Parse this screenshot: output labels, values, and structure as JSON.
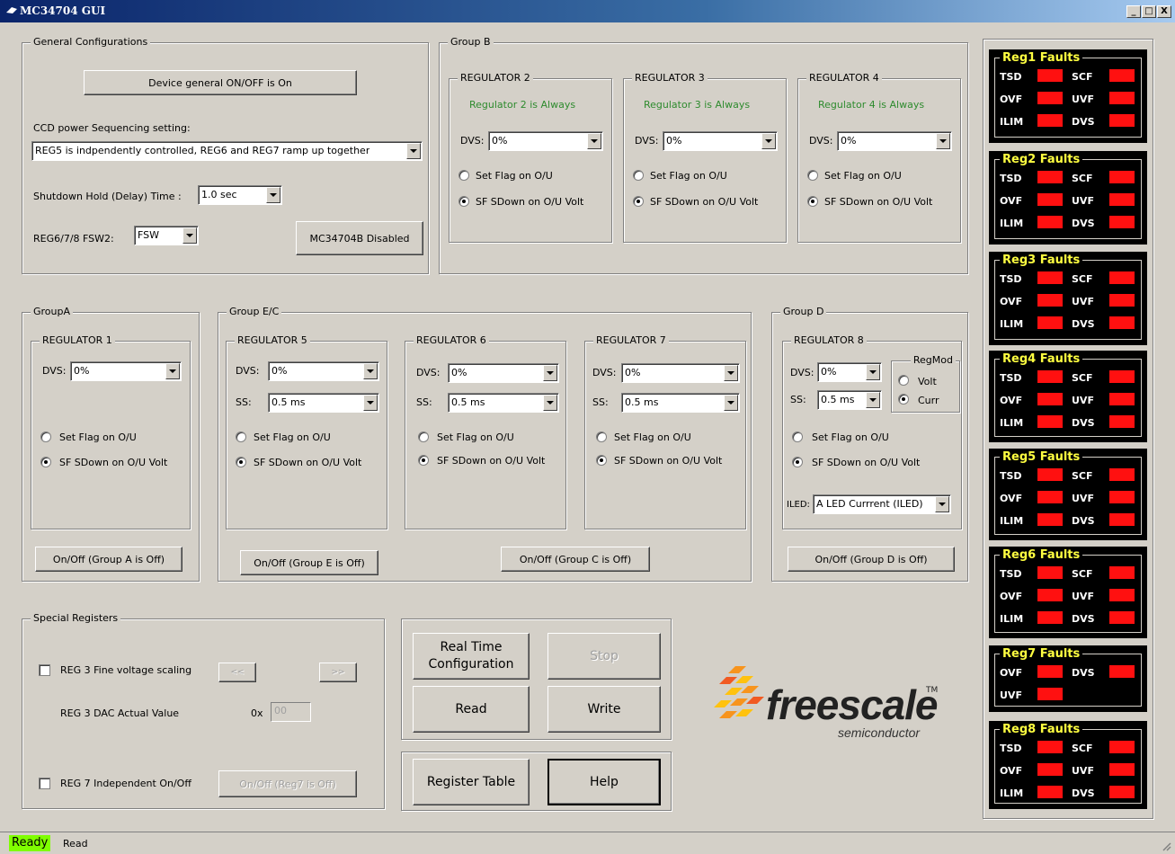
{
  "window": {
    "title": "MC34704 GUI",
    "min": "_",
    "max": "□",
    "close": "X"
  },
  "general": {
    "legend": "General Configurations",
    "device_btn": "Device general ON/OFF is On",
    "ccd_label": "CCD power Sequencing setting:",
    "ccd_value": "REG5 is indpendently controlled, REG6 and REG7 ramp up together",
    "shutdown_label": "Shutdown Hold (Delay) Time :",
    "shutdown_value": "1.0 sec",
    "fsw_label": "REG6/7/8 FSW2:",
    "fsw_value": "FSW",
    "mc_btn": "MC34704B Disabled"
  },
  "groupB": {
    "legend": "Group B",
    "regs": [
      {
        "legend": "REGULATOR 2",
        "always": "Regulator 2 is Always",
        "dvs_label": "DVS:",
        "dvs": "0%",
        "r1": "Set Flag on O/U",
        "r2": "SF SDown on O/U Volt"
      },
      {
        "legend": "REGULATOR 3",
        "always": "Regulator 3 is Always",
        "dvs_label": "DVS:",
        "dvs": "0%",
        "r1": "Set Flag on O/U",
        "r2": "SF SDown on O/U Volt"
      },
      {
        "legend": "REGULATOR 4",
        "always": "Regulator 4 is Always",
        "dvs_label": "DVS:",
        "dvs": "0%",
        "r1": "Set Flag on O/U",
        "r2": "SF SDown on O/U Volt"
      }
    ]
  },
  "groupA": {
    "legend": "GroupA",
    "reg": {
      "legend": "REGULATOR 1",
      "dvs_label": "DVS:",
      "dvs": "0%",
      "r1": "Set Flag on O/U",
      "r2": "SF SDown on O/U Volt"
    },
    "btn": "On/Off (Group A is Off)"
  },
  "groupEC": {
    "legend": "Group E/C",
    "regs": [
      {
        "legend": "REGULATOR 5",
        "dvs_label": "DVS:",
        "dvs": "0%",
        "ss_label": "SS:",
        "ss": "0.5 ms",
        "r1": "Set Flag on O/U",
        "r2": "SF SDown on O/U Volt"
      },
      {
        "legend": "REGULATOR 6",
        "dvs_label": "DVS:",
        "dvs": "0%",
        "ss_label": "SS:",
        "ss": "0.5 ms",
        "r1": "Set Flag on O/U",
        "r2": "SF SDown on O/U Volt"
      },
      {
        "legend": "REGULATOR 7",
        "dvs_label": "DVS:",
        "dvs": "0%",
        "ss_label": "SS:",
        "ss": "0.5 ms",
        "r1": "Set Flag on O/U",
        "r2": "SF SDown on O/U Volt"
      }
    ],
    "btnE": "On/Off (Group E is Off)",
    "btnC": "On/Off (Group C is Off)"
  },
  "groupD": {
    "legend": "Group D",
    "reg": {
      "legend": "REGULATOR 8",
      "dvs_label": "DVS:",
      "dvs": "0%",
      "ss_label": "SS:",
      "ss": "0.5 ms",
      "regmod_legend": "RegMod",
      "volt": "Volt",
      "curr": "Curr",
      "r1": "Set Flag on O/U",
      "r2": "SF SDown on O/U Volt",
      "iled_label": "ILED:",
      "iled": "A LED Currrent (ILED)"
    },
    "btn": "On/Off (Group D is Off)"
  },
  "special": {
    "legend": "Special Registers",
    "fine_label": "REG 3 Fine voltage scaling",
    "prev": "<<",
    "next": ">>",
    "dac_label": "REG 3 DAC Actual Value",
    "dac_prefix": "0x",
    "dac_value": "00",
    "reg7_label": "REG 7 Independent On/Off",
    "reg7_btn": "On/Off (Reg7 is Off)"
  },
  "actions": {
    "realtime": "Real Time Configuration",
    "stop": "Stop",
    "read": "Read",
    "write": "Write",
    "register": "Register Table",
    "help": "Help"
  },
  "logo": {
    "word": "freescale",
    "tm": "TM",
    "sub": "semiconductor",
    "colors": [
      "#f7941d",
      "#ffc20e",
      "#f15a22"
    ]
  },
  "faults": [
    {
      "title": "Reg1 Faults",
      "items": [
        "TSD",
        "SCF",
        "OVF",
        "UVF",
        "ILIM",
        "DVS"
      ]
    },
    {
      "title": "Reg2 Faults",
      "items": [
        "TSD",
        "SCF",
        "OVF",
        "UVF",
        "ILIM",
        "DVS"
      ]
    },
    {
      "title": "Reg3 Faults",
      "items": [
        "TSD",
        "SCF",
        "OVF",
        "UVF",
        "ILIM",
        "DVS"
      ]
    },
    {
      "title": "Reg4 Faults",
      "items": [
        "TSD",
        "SCF",
        "OVF",
        "UVF",
        "ILIM",
        "DVS"
      ]
    },
    {
      "title": "Reg5 Faults",
      "items": [
        "TSD",
        "SCF",
        "OVF",
        "UVF",
        "ILIM",
        "DVS"
      ]
    },
    {
      "title": "Reg6 Faults",
      "items": [
        "TSD",
        "SCF",
        "OVF",
        "UVF",
        "ILIM",
        "DVS"
      ]
    },
    {
      "title": "Reg7 Faults",
      "items": [
        "OVF",
        "DVS",
        "UVF"
      ]
    },
    {
      "title": "Reg8 Faults",
      "items": [
        "TSD",
        "SCF",
        "OVF",
        "UVF",
        "ILIM",
        "DVS"
      ]
    }
  ],
  "status": {
    "ready": "Ready",
    "msg": "Read"
  }
}
